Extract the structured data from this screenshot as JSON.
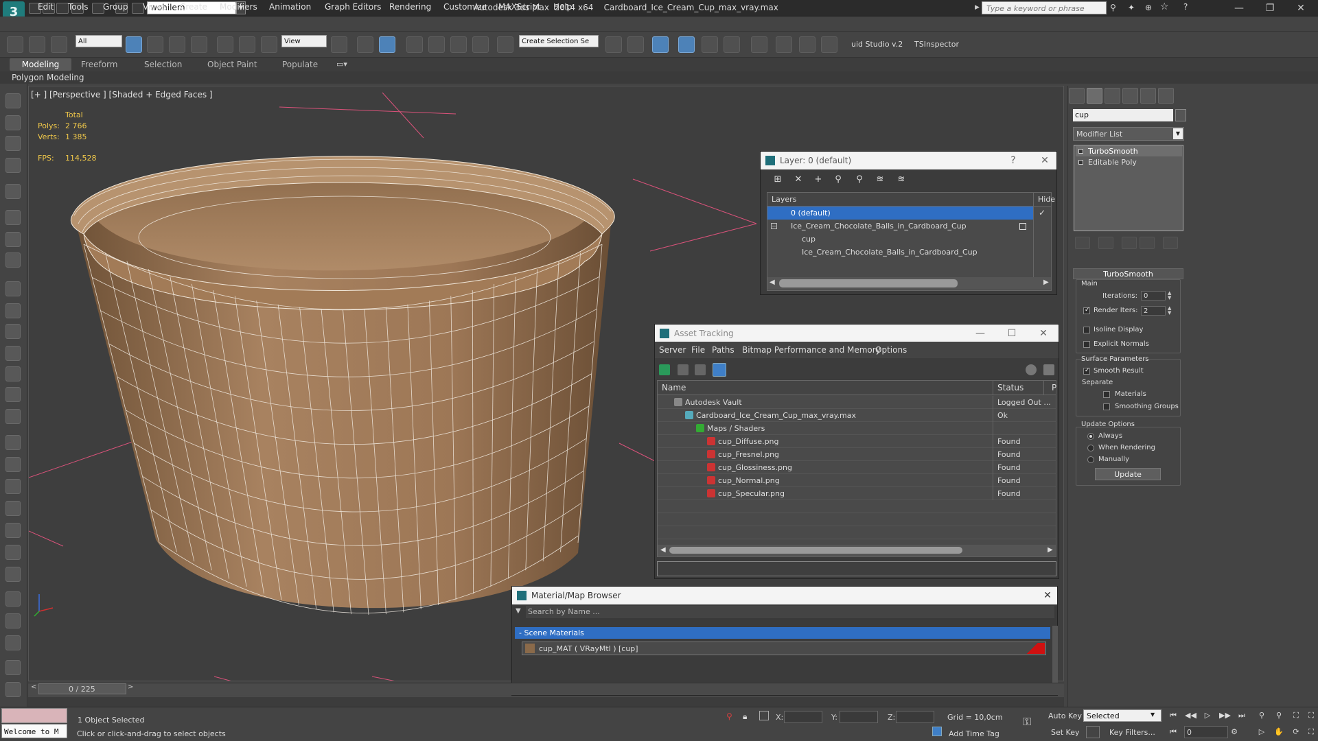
{
  "app": {
    "title": "Autodesk 3ds Max  2014 x64    Cardboard_Ice_Cream_Cup_max_vray.max",
    "workspace": "wohilem",
    "search_placeholder": "Type a keyword or phrase",
    "logo": "3ds-max-logo"
  },
  "menu": [
    "Edit",
    "Tools",
    "Group",
    "Views",
    "Create",
    "Modifiers",
    "Animation",
    "Graph Editors",
    "Rendering",
    "Customize",
    "MAXScript",
    "Help"
  ],
  "toolbar": {
    "selection_filter": "All",
    "ref_coord": "View",
    "named_selection": "Create Selection Se",
    "plugin1": "uid Studio v.2",
    "plugin2": "TSInspector"
  },
  "ribbon": {
    "tabs": [
      "Modeling",
      "Freeform",
      "Selection",
      "Object Paint",
      "Populate"
    ],
    "sub_label": "Polygon Modeling"
  },
  "viewport": {
    "label": "[+ ] [Perspective ] [Shaded + Edged Faces ]",
    "stats_header": "Total",
    "polys_label": "Polys:",
    "polys_value": "2 766",
    "verts_label": "Verts:",
    "verts_value": "1 385",
    "fps_label": "FPS:",
    "fps_value": "114,528",
    "cup_color": "#a57d58"
  },
  "command_panel": {
    "object_name": "cup",
    "modifier_list": "Modifier List",
    "stack": [
      "TurboSmooth",
      "Editable Poly"
    ]
  },
  "turbosmooth": {
    "title": "TurboSmooth",
    "main": "Main",
    "iterations_label": "Iterations:",
    "iterations": "0",
    "render_iters_label": "Render Iters:",
    "render_iters": "2",
    "isoline": "Isoline Display",
    "explicit_normals": "Explicit Normals",
    "surface_params": "Surface Parameters",
    "smooth_result": "Smooth Result",
    "separate": "Separate",
    "materials": "Materials",
    "smoothing_groups": "Smoothing Groups",
    "update_options": "Update Options",
    "always": "Always",
    "when_rendering": "When Rendering",
    "manually": "Manually",
    "update_button": "Update"
  },
  "layer_dialog": {
    "title": "Layer: 0 (default)",
    "col_layers": "Layers",
    "col_hide": "Hide",
    "rows": [
      "0 (default)",
      "Ice_Cream_Chocolate_Balls_in_Cardboard_Cup",
      "cup",
      "Ice_Cream_Chocolate_Balls_in_Cardboard_Cup"
    ]
  },
  "asset_dialog": {
    "title": "Asset Tracking",
    "menu": [
      "Server",
      "File",
      "Paths",
      "Bitmap Performance and Memory",
      "Options"
    ],
    "col_name": "Name",
    "col_status": "Status",
    "col_p": "P",
    "rows": [
      {
        "name": "Autodesk Vault",
        "status": "Logged Out ..."
      },
      {
        "name": "Cardboard_Ice_Cream_Cup_max_vray.max",
        "status": "Ok"
      },
      {
        "name": "Maps / Shaders",
        "status": ""
      },
      {
        "name": "cup_Diffuse.png",
        "status": "Found"
      },
      {
        "name": "cup_Fresnel.png",
        "status": "Found"
      },
      {
        "name": "cup_Glossiness.png",
        "status": "Found"
      },
      {
        "name": "cup_Normal.png",
        "status": "Found"
      },
      {
        "name": "cup_Specular.png",
        "status": "Found"
      }
    ]
  },
  "material_dialog": {
    "title": "Material/Map Browser",
    "search_placeholder": "Search by Name ...",
    "group": "- Scene Materials",
    "item": "cup_MAT  ( VRayMtl )  [cup]"
  },
  "timeline": {
    "frame": "0 / 225"
  },
  "status": {
    "script_text": "Welcome to M",
    "selected": "1 Object Selected",
    "prompt": "Click or click-and-drag to select objects",
    "x_label": "X:",
    "y_label": "Y:",
    "z_label": "Z:",
    "grid": "Grid = 10,0cm",
    "add_time_tag": "Add Time Tag",
    "auto_key": "Auto Key",
    "set_key": "Set Key",
    "selection_set": "Selected",
    "key_filters": "Key Filters...",
    "current_frame": "0"
  }
}
